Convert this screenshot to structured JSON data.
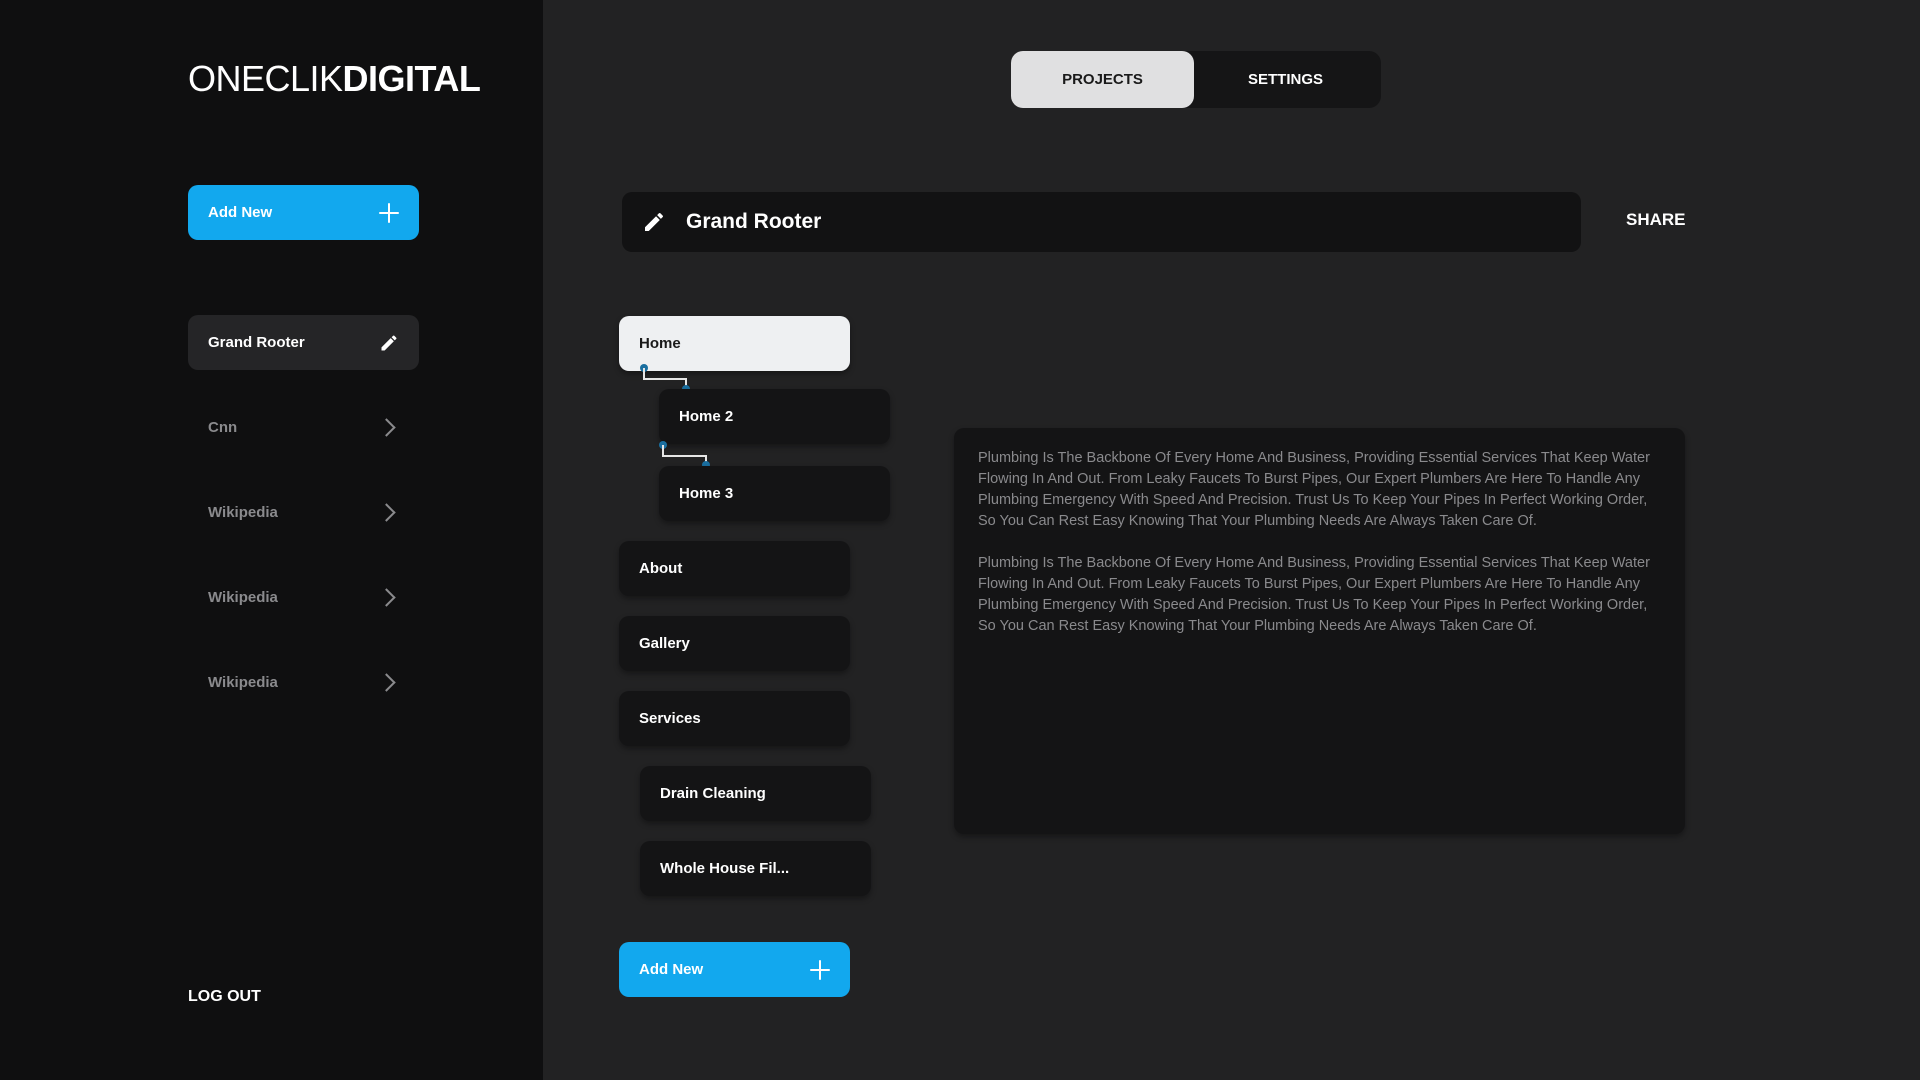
{
  "brand": {
    "logo_light": "ONECLIK",
    "logo_bold": "DIGITAL"
  },
  "sidebar": {
    "add_new_label": "Add New",
    "projects": [
      {
        "label": "Grand Rooter",
        "active": true,
        "icon": "pencil-icon"
      },
      {
        "label": "Cnn",
        "active": false,
        "icon": "chevron-right-icon"
      },
      {
        "label": "Wikipedia",
        "active": false,
        "icon": "chevron-right-icon"
      },
      {
        "label": "Wikipedia",
        "active": false,
        "icon": "chevron-right-icon"
      },
      {
        "label": "Wikipedia",
        "active": false,
        "icon": "chevron-right-icon"
      }
    ],
    "logout_label": "LOG OUT"
  },
  "tabs": [
    {
      "label": "PROJECTS",
      "active": true
    },
    {
      "label": "SETTINGS",
      "active": false
    }
  ],
  "project": {
    "title": "Grand Rooter",
    "share_label": "SHARE"
  },
  "pages": [
    {
      "label": "Home",
      "active": true
    },
    {
      "label": "Home 2",
      "active": false
    },
    {
      "label": "Home 3",
      "active": false
    },
    {
      "label": "About",
      "active": false
    },
    {
      "label": "Gallery",
      "active": false
    },
    {
      "label": "Services",
      "active": false
    },
    {
      "label": "Drain Cleaning",
      "active": false
    },
    {
      "label": "Whole House Fil...",
      "active": false
    }
  ],
  "pages_add_new_label": "Add New",
  "content": {
    "paragraphs": [
      "Plumbing Is The Backbone Of Every Home And Business, Providing Essential Services That Keep Water Flowing In And Out. From Leaky Faucets To Burst Pipes, Our Expert Plumbers Are Here To Handle Any Plumbing Emergency With Speed And Precision. Trust Us To Keep Your Pipes In Perfect Working Order, So You Can Rest Easy Knowing That Your Plumbing Needs Are Always Taken Care Of.",
      "Plumbing Is The Backbone Of Every Home And Business, Providing Essential Services That Keep Water Flowing In And Out. From Leaky Faucets To Burst Pipes, Our Expert Plumbers Are Here To Handle Any Plumbing Emergency With Speed And Precision. Trust Us To Keep Your Pipes In Perfect Working Order, So You Can Rest Easy Knowing That Your Plumbing Needs Are Always Taken Care Of."
    ]
  },
  "colors": {
    "accent": "#12a8ee",
    "sidebar_bg": "#0f0f10",
    "main_bg": "#222223",
    "connector_dot": "#1a6fa0"
  }
}
